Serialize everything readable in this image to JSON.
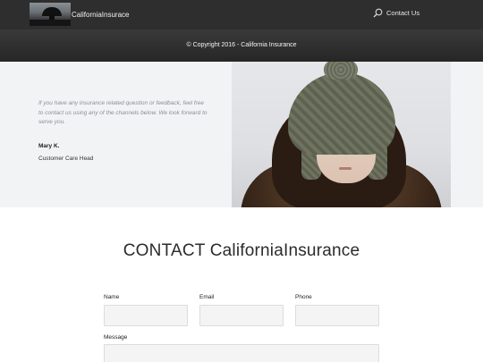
{
  "header": {
    "brand": "CaliforniaInsurace",
    "contact_link": "Contact Us"
  },
  "copyright": "© Copyright 2016 - California Insurance",
  "testimonial": {
    "quote": "If you have any insurance related question or feedback, feel free to contact us using any of the channels below. We look forward to serve you.",
    "author": "Mary K.",
    "role": "Customer Care Head"
  },
  "contact": {
    "title": "CONTACT CaliforniaInsurance",
    "name_label": "Name",
    "email_label": "Email",
    "phone_label": "Phone",
    "message_label": "Message"
  }
}
